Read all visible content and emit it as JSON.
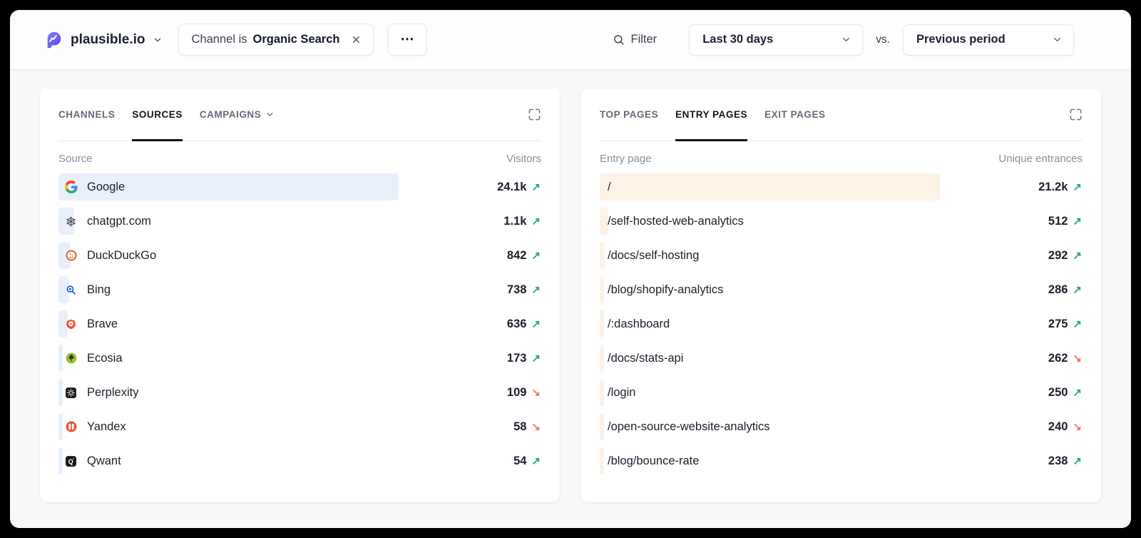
{
  "header": {
    "site_name": "plausible.io",
    "filter_chip": {
      "prefix": "Channel is",
      "value": "Organic Search"
    },
    "more_label": "⋯",
    "filter_label": "Filter",
    "date_range_value": "Last 30 days",
    "vs_label": "vs.",
    "comparison_value": "Previous period"
  },
  "left_panel": {
    "tabs": [
      {
        "label": "CHANNELS",
        "active": false
      },
      {
        "label": "SOURCES",
        "active": true
      },
      {
        "label": "CAMPAIGNS",
        "active": false,
        "has_dropdown": true
      }
    ],
    "columns": {
      "name": "Source",
      "value": "Visitors"
    },
    "max_value": 24100,
    "bar_color": "#e9f0fb",
    "rows": [
      {
        "label": "Google",
        "icon": "google-icon",
        "value": "24.1k",
        "raw": 24100,
        "trend": "up"
      },
      {
        "label": "chatgpt.com",
        "icon": "chatgpt-icon",
        "value": "1.1k",
        "raw": 1100,
        "trend": "up"
      },
      {
        "label": "DuckDuckGo",
        "icon": "duckduckgo-icon",
        "value": "842",
        "raw": 842,
        "trend": "up"
      },
      {
        "label": "Bing",
        "icon": "bing-icon",
        "value": "738",
        "raw": 738,
        "trend": "up"
      },
      {
        "label": "Brave",
        "icon": "brave-icon",
        "value": "636",
        "raw": 636,
        "trend": "up"
      },
      {
        "label": "Ecosia",
        "icon": "ecosia-icon",
        "value": "173",
        "raw": 173,
        "trend": "up"
      },
      {
        "label": "Perplexity",
        "icon": "perplexity-icon",
        "value": "109",
        "raw": 109,
        "trend": "down"
      },
      {
        "label": "Yandex",
        "icon": "yandex-icon",
        "value": "58",
        "raw": 58,
        "trend": "down"
      },
      {
        "label": "Qwant",
        "icon": "qwant-icon",
        "value": "54",
        "raw": 54,
        "trend": "up"
      }
    ]
  },
  "right_panel": {
    "tabs": [
      {
        "label": "TOP PAGES",
        "active": false
      },
      {
        "label": "ENTRY PAGES",
        "active": true
      },
      {
        "label": "EXIT PAGES",
        "active": false
      }
    ],
    "columns": {
      "name": "Entry page",
      "value": "Unique entrances"
    },
    "max_value": 21200,
    "bar_color": "#fcf2e5",
    "rows": [
      {
        "label": "/",
        "value": "21.2k",
        "raw": 21200,
        "trend": "up"
      },
      {
        "label": "/self-hosted-web-analytics",
        "value": "512",
        "raw": 512,
        "trend": "up"
      },
      {
        "label": "/docs/self-hosting",
        "value": "292",
        "raw": 292,
        "trend": "up"
      },
      {
        "label": "/blog/shopify-analytics",
        "value": "286",
        "raw": 286,
        "trend": "up"
      },
      {
        "label": "/:dashboard",
        "value": "275",
        "raw": 275,
        "trend": "up"
      },
      {
        "label": "/docs/stats-api",
        "value": "262",
        "raw": 262,
        "trend": "down"
      },
      {
        "label": "/login",
        "value": "250",
        "raw": 250,
        "trend": "up"
      },
      {
        "label": "/open-source-website-analytics",
        "value": "240",
        "raw": 240,
        "trend": "down"
      },
      {
        "label": "/blog/bounce-rate",
        "value": "238",
        "raw": 238,
        "trend": "up"
      }
    ]
  },
  "colors": {
    "brand": "#5d55e8",
    "trend_up": "#2aa775",
    "trend_down": "#f2736c"
  },
  "glyphs": {
    "trend_up": "↗",
    "trend_down": "↘"
  }
}
